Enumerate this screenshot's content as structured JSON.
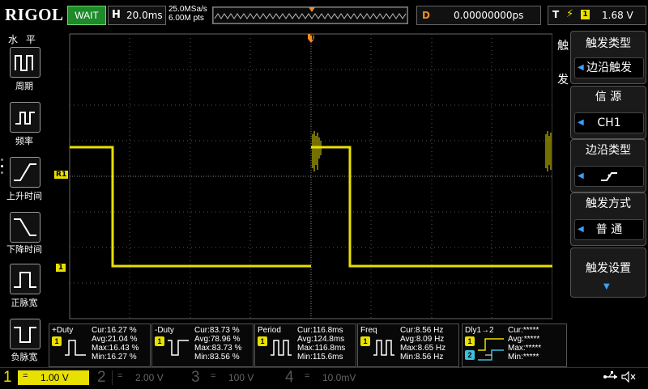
{
  "header": {
    "brand": "RIGOL",
    "run_state": "WAIT",
    "timebase_label": "H",
    "timebase_value": "20.0ms",
    "sample_rate": "25.0MSa/s",
    "memory_depth": "6.00M pts",
    "delay_label": "D",
    "delay_value": "0.00000000ps",
    "trigger_label": "T",
    "trigger_source_num": "1",
    "trigger_level": "1.68 V"
  },
  "left_menu": {
    "title": "水 平",
    "items": [
      {
        "label": "周期"
      },
      {
        "label": "频率"
      },
      {
        "label": "上升时间"
      },
      {
        "label": "下降时间"
      },
      {
        "label": "正脉宽"
      },
      {
        "label": "负脉宽"
      }
    ]
  },
  "right_menu": {
    "side_label_1": "触",
    "side_label_2": "发",
    "trigger_type_title": "触发类型",
    "trigger_type_value": "边沿触发",
    "source_title": "信 源",
    "source_value": "CH1",
    "edge_title": "边沿类型",
    "mode_title": "触发方式",
    "mode_value": "普 通",
    "settings_title": "触发设置"
  },
  "markers": {
    "ch1_ref": "1",
    "ch1_level": "1",
    "trig_marker": "T"
  },
  "measurements": [
    {
      "name": "+Duty",
      "src": "1",
      "cur": "Cur:16.27 %",
      "avg": "Avg:21.04 %",
      "max": "Max:16.43 %",
      "min": "Min:16.27 %"
    },
    {
      "name": "-Duty",
      "src": "1",
      "cur": "Cur:83.73 %",
      "avg": "Avg:78.96 %",
      "max": "Max:83.73 %",
      "min": "Min:83.56 %"
    },
    {
      "name": "Period",
      "src": "1",
      "cur": "Cur:116.8ms",
      "avg": "Avg:124.8ms",
      "max": "Max:116.8ms",
      "min": "Min:115.6ms"
    },
    {
      "name": "Freq",
      "src": "1",
      "cur": "Cur:8.56 Hz",
      "avg": "Avg:8.09 Hz",
      "max": "Max:8.65 Hz",
      "min": "Min:8.56 Hz"
    },
    {
      "name": "Dly1→2",
      "src": "1",
      "src2": "2",
      "cur": "Cur:*****",
      "avg": "Avg:*****",
      "max": "Max:*****",
      "min": "Min:*****"
    }
  ],
  "channels": [
    {
      "num": "1",
      "coupling": "=",
      "scale": "1.00 V",
      "color": "#e8e000"
    },
    {
      "num": "2",
      "coupling": "=",
      "scale": "2.00 V",
      "color": "#3aa0ff"
    },
    {
      "num": "3",
      "coupling": "=",
      "scale": "100 V",
      "color": "#e040c0"
    },
    {
      "num": "4",
      "coupling": "=",
      "scale": "10.0mV",
      "color": "#1e60ff"
    }
  ],
  "colors": {
    "ch1": "#e8e000",
    "trigger": "#f08c28",
    "accent": "#3aa0ff",
    "run_state_bg": "#1f8a2a"
  },
  "icons": {
    "usb": "usb-icon",
    "speaker": "speaker-muted-icon"
  }
}
